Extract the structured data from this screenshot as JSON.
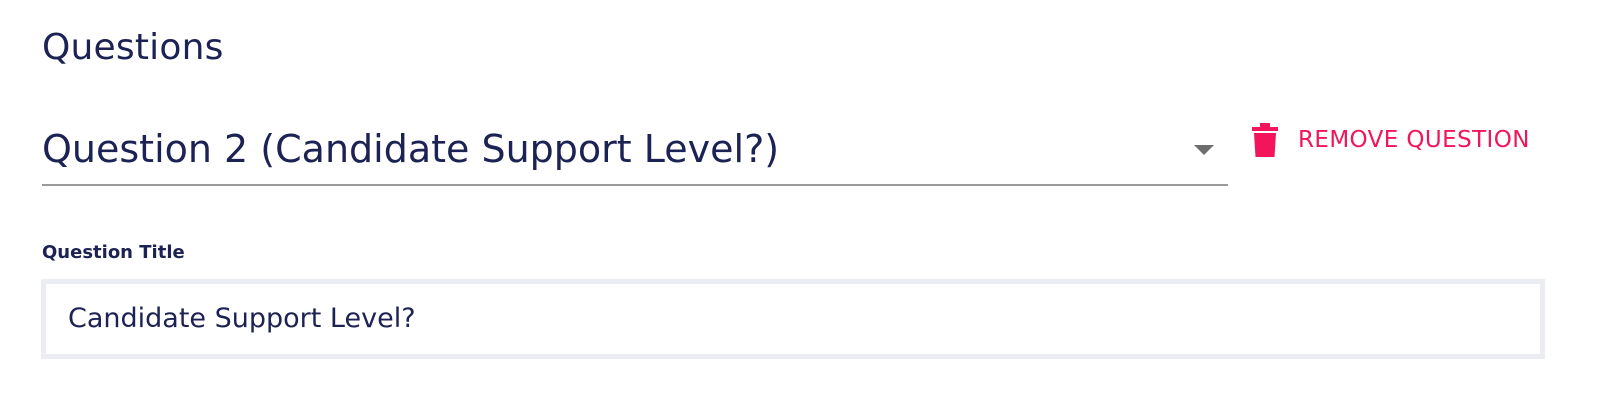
{
  "section": {
    "title": "Questions"
  },
  "question_select": {
    "selected_value": "Question 2 (Candidate Support Level?)",
    "arrow_icon": "dropdown-arrow-icon"
  },
  "remove_button": {
    "label": "REMOVE QUESTION",
    "icon": "trash-icon",
    "color": "#f2155b"
  },
  "question_title_field": {
    "label": "Question Title",
    "value": "Candidate Support Level?"
  },
  "colors": {
    "text_primary": "#1c2253",
    "accent": "#f2155b",
    "underline": "#9a9a9a",
    "input_border": "#ececf3"
  }
}
